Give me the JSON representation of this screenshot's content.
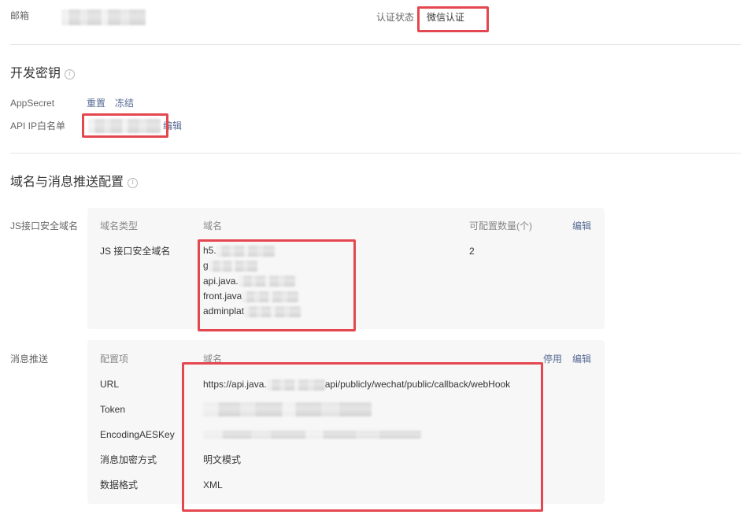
{
  "account": {
    "email_label": "邮箱",
    "auth_label": "认证状态",
    "auth_value": "微信认证"
  },
  "dev_key": {
    "title": "开发密钥",
    "appsecret_label": "AppSecret",
    "reset_link": "重置",
    "freeze_link": "冻结",
    "ip_whitelist_label": "API IP白名单",
    "ip_whitelist_edit": "编辑"
  },
  "domain_config": {
    "title": "域名与消息推送配置",
    "js_domain": {
      "label": "JS接口安全域名",
      "headers": {
        "type": "域名类型",
        "domain": "域名",
        "count": "可配置数量(个)",
        "edit": "编辑"
      },
      "row": {
        "type": "JS 接口安全域名",
        "domains": [
          "h5.",
          "g",
          "api.java.",
          "front.java",
          "adminplat"
        ],
        "count": "2"
      }
    },
    "push": {
      "label": "消息推送",
      "headers": {
        "item": "配置项",
        "domain": "域名",
        "disable": "停用",
        "edit": "编辑"
      },
      "rows": [
        {
          "label": "URL",
          "value_prefix": "https://api.java.",
          "value_suffix": "api/publicly/wechat/public/callback/webHook"
        },
        {
          "label": "Token"
        },
        {
          "label": "EncodingAESKey"
        },
        {
          "label": "消息加密方式",
          "value": "明文模式"
        },
        {
          "label": "数据格式",
          "value": "XML"
        }
      ]
    }
  },
  "colors": {
    "link": "#576b95",
    "highlight": "#e3474f",
    "card_bg": "#f7f7f7"
  },
  "icons": {
    "section_help": "info-circle-icon"
  }
}
